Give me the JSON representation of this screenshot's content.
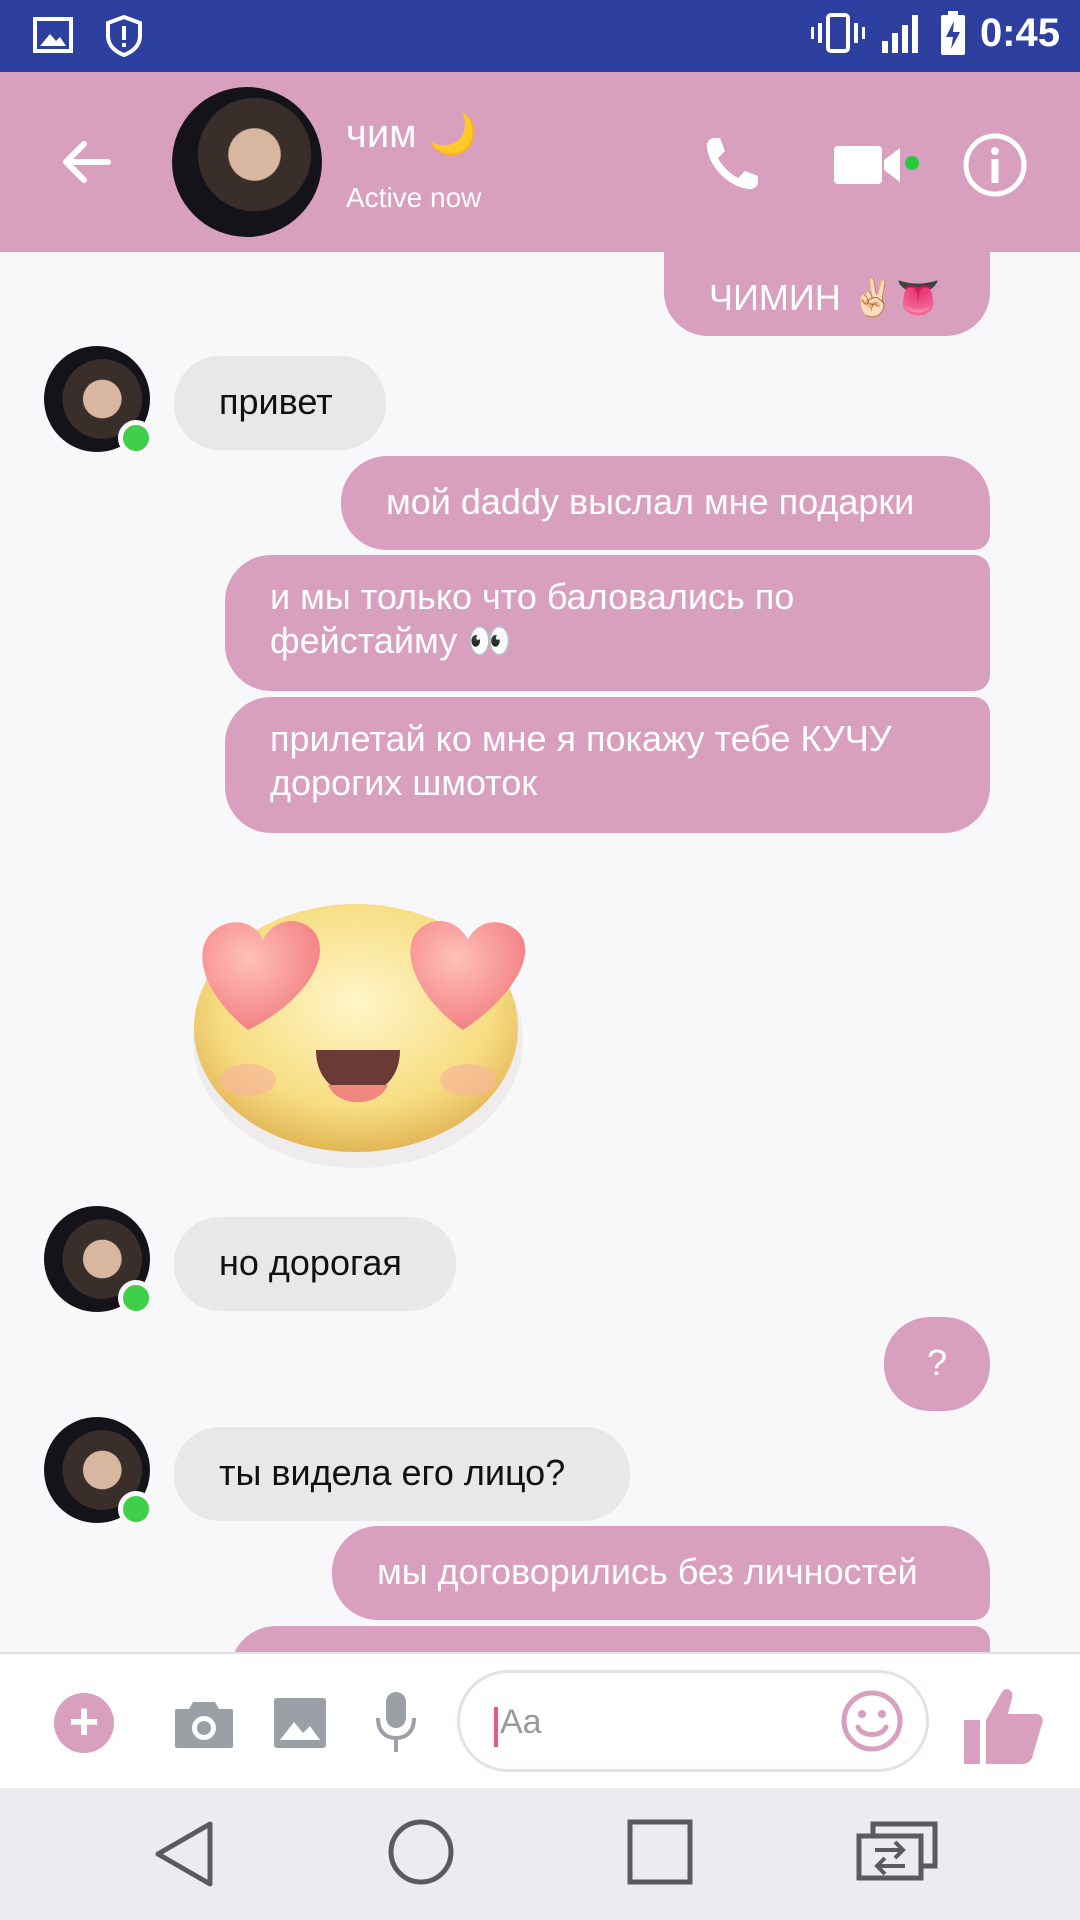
{
  "status_bar": {
    "time": "0:45",
    "icons": [
      "image-icon",
      "shield-icon",
      "vibrate-icon",
      "signal-icon",
      "battery-charging-icon"
    ]
  },
  "header": {
    "contact_name": "чим 🌙",
    "status": "Active now",
    "accent_color": "#d99fbe"
  },
  "messages": [
    {
      "dir": "out",
      "text": "ЧИМИН ✌🏻👅"
    },
    {
      "dir": "in",
      "text": "привет"
    },
    {
      "dir": "out",
      "text": "мой daddy выслал мне подарки"
    },
    {
      "dir": "out",
      "text": "и мы только что баловались по фейстайму 👀"
    },
    {
      "dir": "out",
      "text": "прилетай ко мне я покажу тебе КУЧУ дорогих шмоток"
    },
    {
      "dir": "in",
      "sticker": "heart-eyes-sticker"
    },
    {
      "dir": "in",
      "text": "но дорогая"
    },
    {
      "dir": "out",
      "text": "?"
    },
    {
      "dir": "in",
      "text": "ты видела его лицо?"
    },
    {
      "dir": "out",
      "text": "мы договорились без личностей"
    }
  ],
  "composer": {
    "placeholder": "Aa",
    "plus_label": "+"
  },
  "colors": {
    "status_bar": "#2d40a0",
    "outgoing_bubble": "#d99fbe",
    "incoming_bubble": "#e8e7ea",
    "online_dot": "#3fcf4a"
  }
}
